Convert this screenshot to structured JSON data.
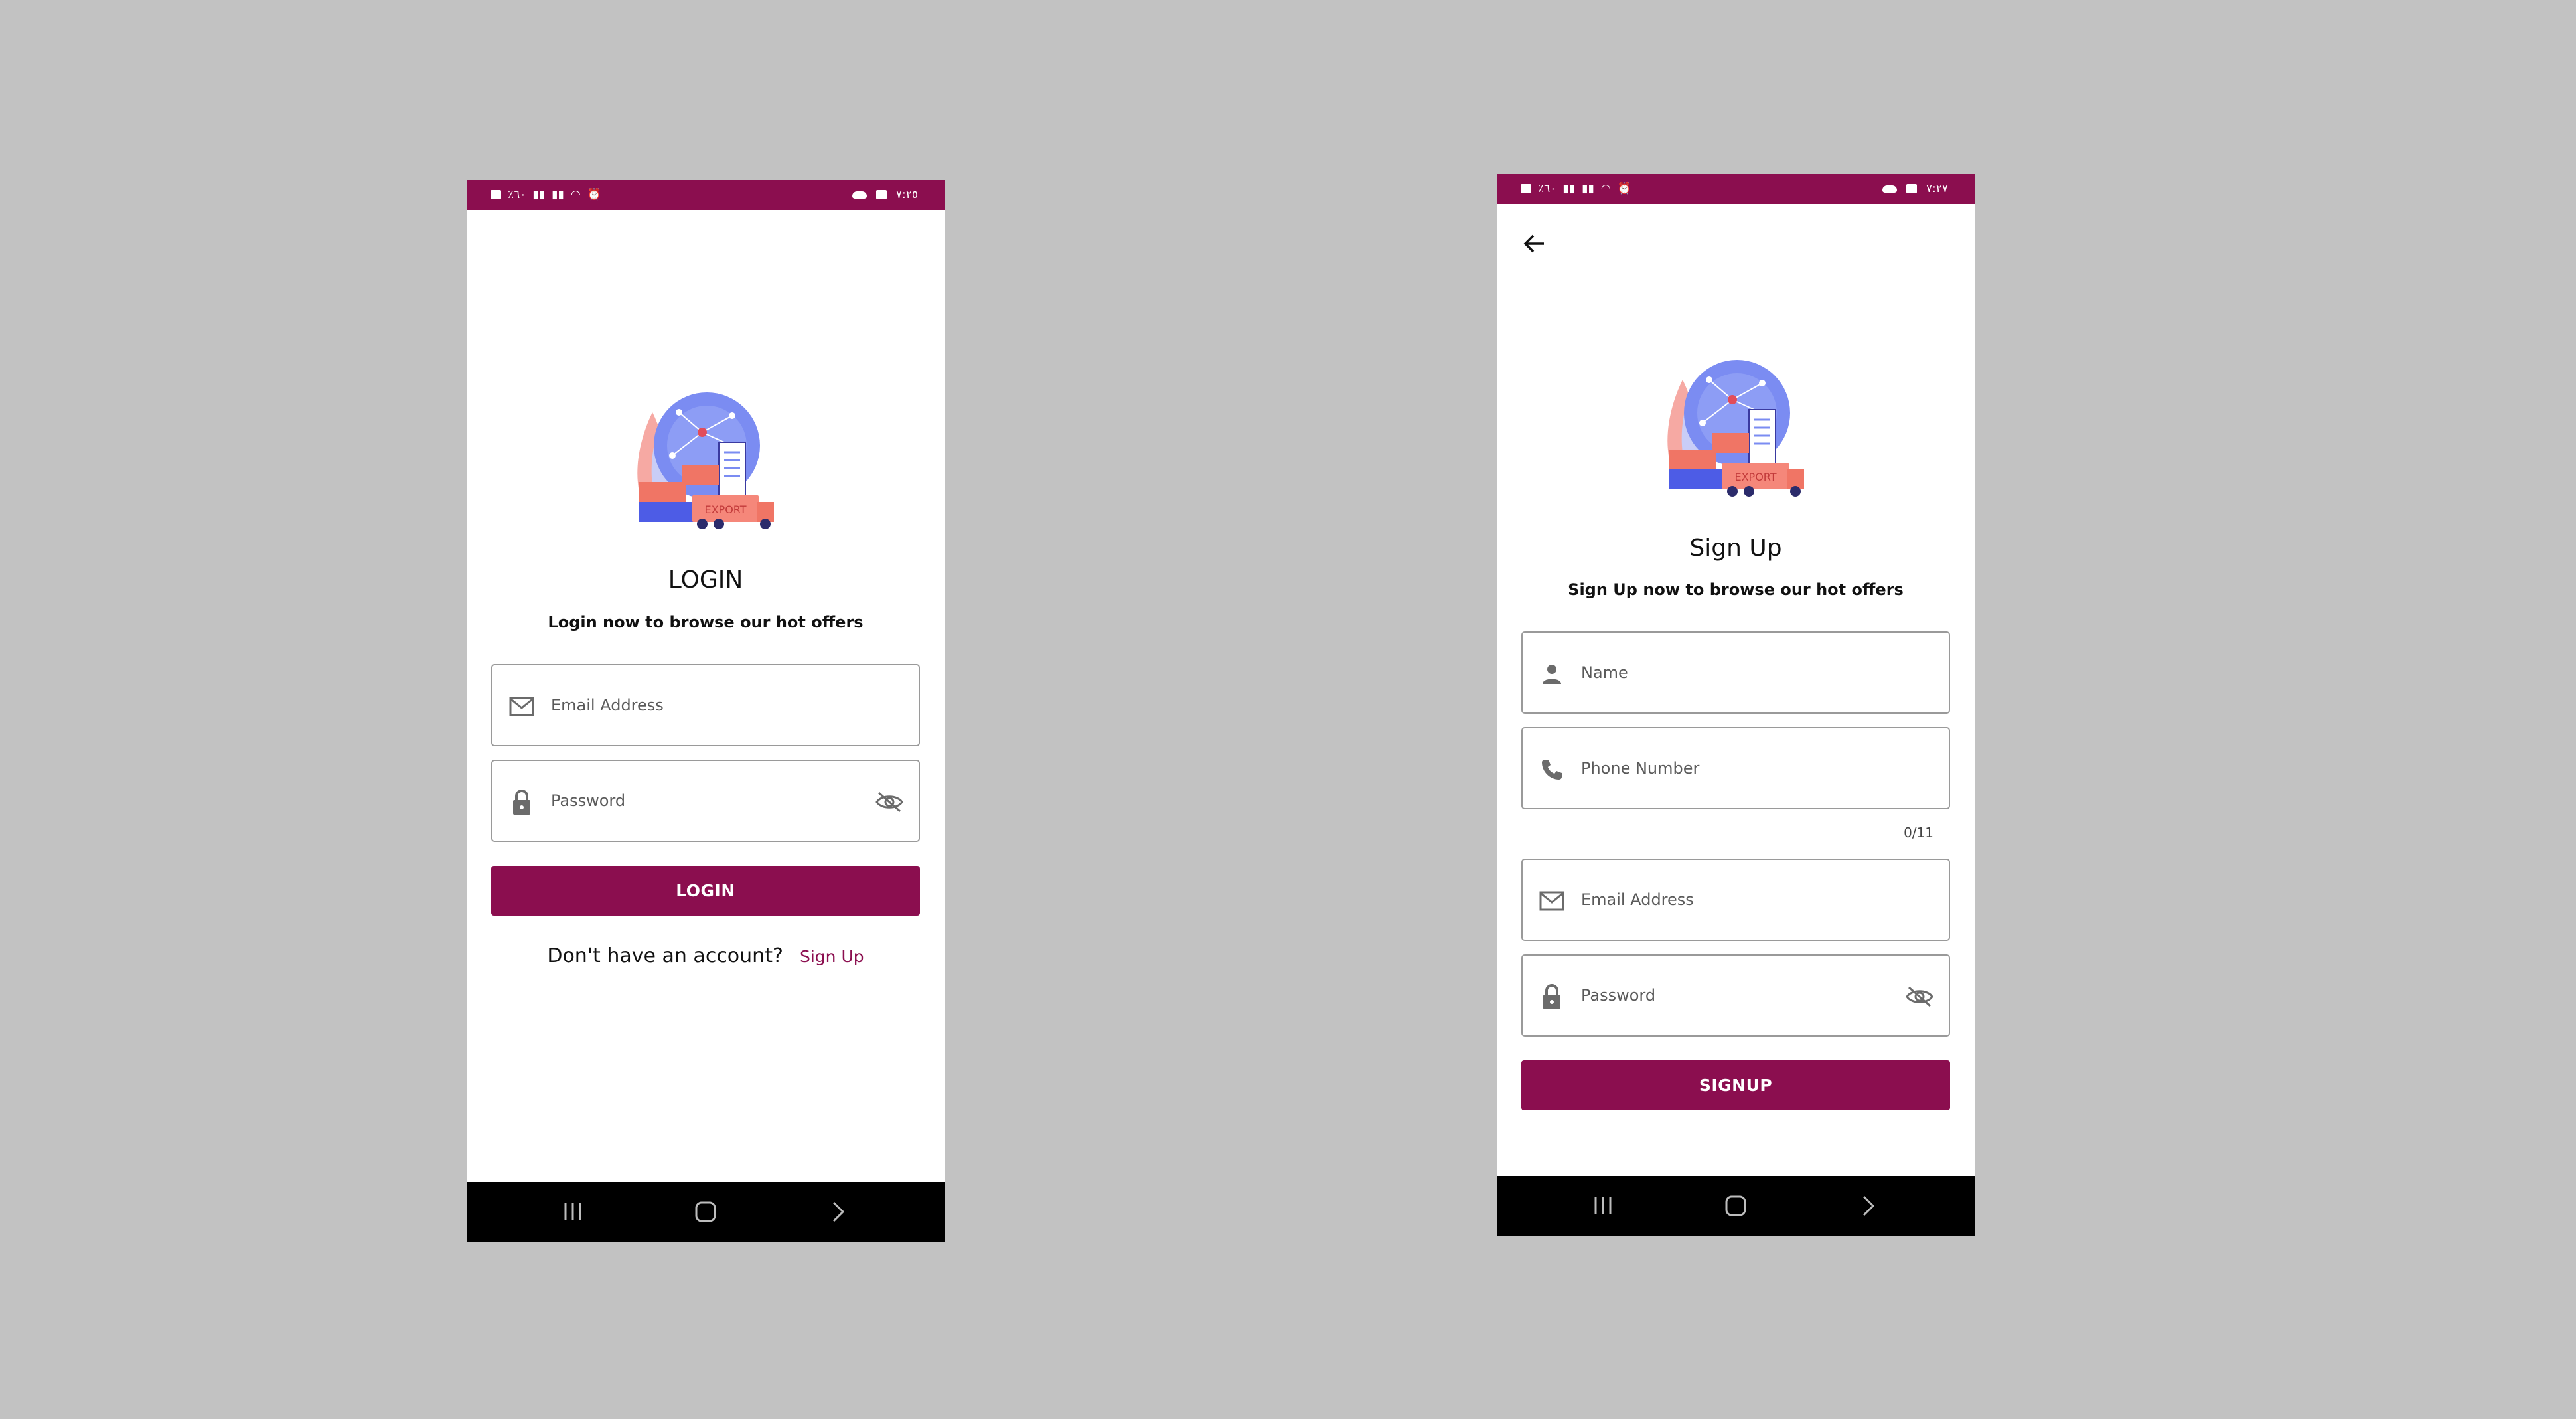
{
  "status_bar": {
    "left_text": "٪٦٠",
    "time": "٧:٢٥",
    "time_signup": "٧:٢٧"
  },
  "illustration": {
    "badge": "EXPORT"
  },
  "login": {
    "title": "LOGIN",
    "subtitle": "Login now to browse our hot offers",
    "email_placeholder": "Email Address",
    "password_placeholder": "Password",
    "button_label": "LOGIN",
    "no_account_text": "Don't have an account?",
    "signup_link": "Sign Up"
  },
  "signup": {
    "title": "Sign Up",
    "subtitle": "Sign Up now to browse our hot offers",
    "name_placeholder": "Name",
    "phone_placeholder": "Phone Number",
    "phone_counter": "0/11",
    "email_placeholder": "Email Address",
    "password_placeholder": "Password",
    "button_label": "SIGNUP"
  },
  "icons": {
    "email": "mail-icon",
    "password": "lock-icon",
    "visibility": "eye-off-icon",
    "name": "person-icon",
    "phone": "phone-icon",
    "back": "arrow-left-icon"
  },
  "colors": {
    "brand": "#8b0e4f",
    "background": "#c2c2c2",
    "nav_bar": "#000000"
  }
}
